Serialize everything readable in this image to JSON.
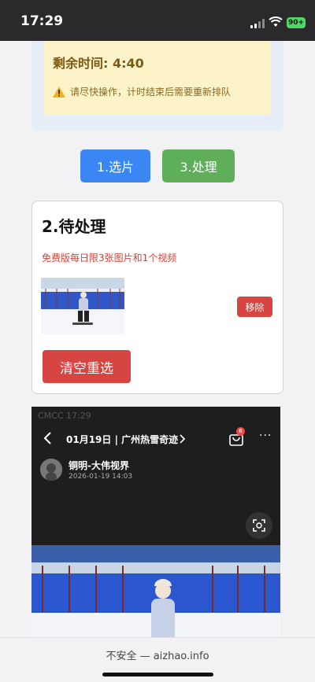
{
  "status_bar": {
    "time": "17:29",
    "battery": "90+"
  },
  "timer": {
    "remaining": "剩余时间: 4:40",
    "warning": "请尽快操作，计时结束后需要重新排队"
  },
  "steps": {
    "select_label": "1.选片",
    "process_label": "3.处理"
  },
  "pending_card": {
    "title": "2.待处理",
    "note": "免费版每日限3张图片和1个视频",
    "remove_label": "移除",
    "clear_label": "清空重选"
  },
  "embedded_shot": {
    "status": "CMCC 17:29",
    "title": "01月19日 | 广州热雪奇迹",
    "badge": "6",
    "more": "···",
    "user": "铜明-大伟视界",
    "date": "2026-01-19 14:03"
  },
  "browser": {
    "url_text": "不安全 — aizhao.info"
  },
  "colors": {
    "select_button": "#3a87f4",
    "process_button": "#5eae5a",
    "danger": "#d64541",
    "timer_bg": "#fdf3c8"
  }
}
